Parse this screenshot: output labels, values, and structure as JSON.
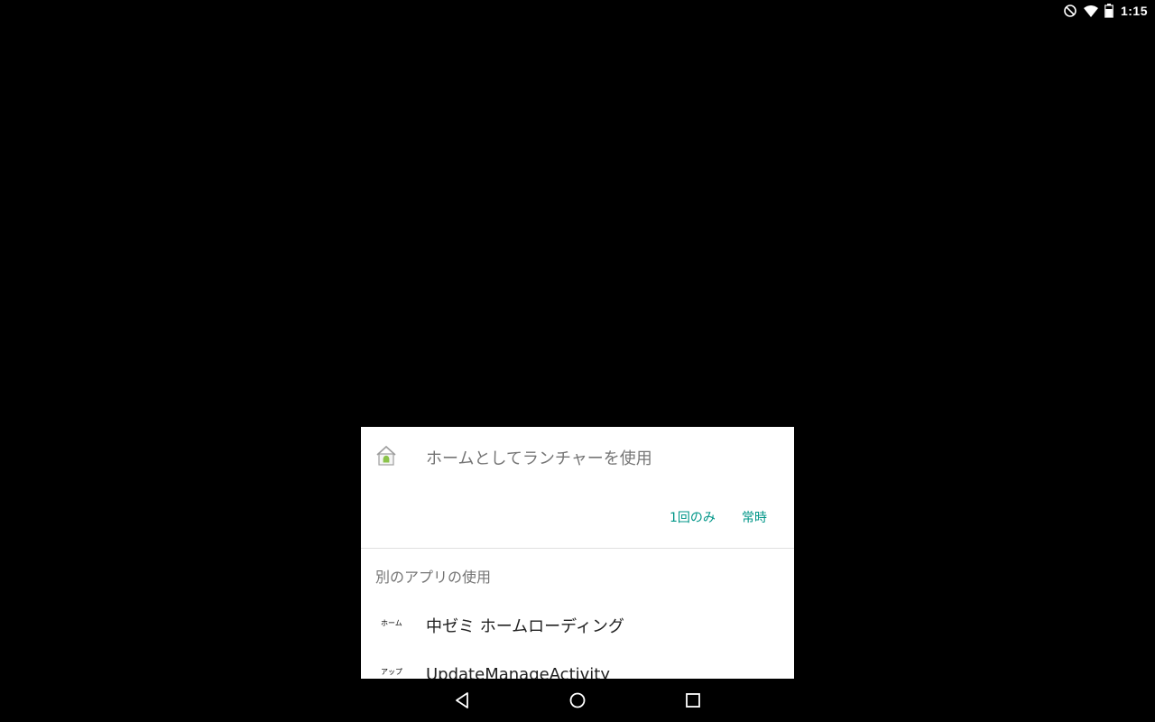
{
  "status_bar": {
    "time": "1:15",
    "icons": [
      "do-not-disturb-icon",
      "wifi-icon",
      "battery-icon"
    ]
  },
  "dialog": {
    "title": "ホームとしてランチャーを使用",
    "app_icon": "launcher-home-icon",
    "buttons": {
      "once_label": "1回のみ",
      "always_label": "常時"
    },
    "section_label": "別のアプリの使用",
    "items": [
      {
        "icon_text": "ホーム",
        "label": "中ゼミ ホームローディング"
      },
      {
        "icon_text": "アップ",
        "label": "UpdateManageActivity"
      }
    ]
  },
  "colors": {
    "accent": "#009688",
    "title_gray": "#757575",
    "item_text": "#212121",
    "background": "#000000",
    "dialog_bg": "#ffffff"
  },
  "nav_bar": {
    "icons": [
      "back-icon",
      "home-icon",
      "recents-icon"
    ]
  }
}
